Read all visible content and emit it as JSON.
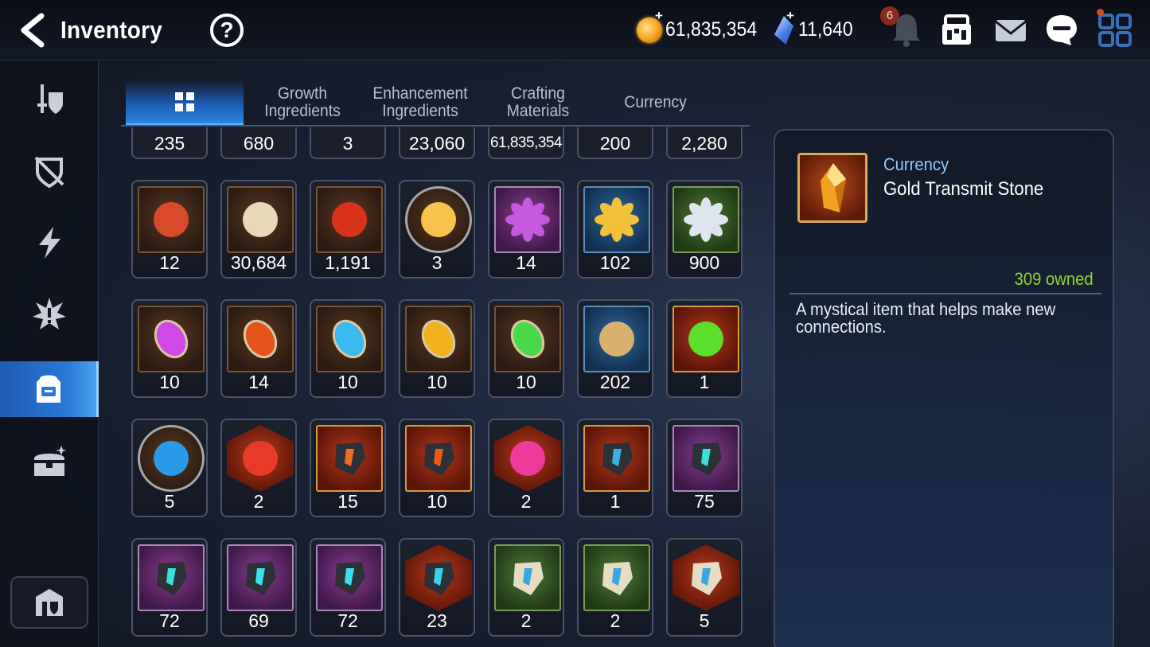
{
  "header": {
    "title": "Inventory",
    "gold_amount": "61,835,354",
    "crystal_amount": "11,640",
    "notification_count": "6",
    "currency_plus": "+"
  },
  "sidebar": {
    "items": [
      {
        "icon": "sword-shield-icon"
      },
      {
        "icon": "broken-shield-icon"
      },
      {
        "icon": "lightning-icon"
      },
      {
        "icon": "burst-icon"
      },
      {
        "icon": "backpack-icon",
        "active": true
      },
      {
        "icon": "chest-icon"
      }
    ],
    "bottom_icon": "fortress-icon"
  },
  "tabs": [
    {
      "label": "",
      "icon": "grid-icon",
      "active": true
    },
    {
      "label": "Growth Ingredients"
    },
    {
      "label": "Enhancement Ingredients"
    },
    {
      "label": "Crafting Materials"
    },
    {
      "label": "Currency"
    }
  ],
  "partial_row_counts": [
    "235",
    "680",
    "3",
    "23,060",
    "61,835,354",
    "200",
    "2,280"
  ],
  "items": [
    {
      "count": "12",
      "icon": "war-banner-icon",
      "frame": "brown"
    },
    {
      "count": "30,684",
      "icon": "horse-statue-icon",
      "frame": "brown"
    },
    {
      "count": "1,191",
      "icon": "red-leaf-icon",
      "frame": "brown"
    },
    {
      "count": "3",
      "icon": "chick-mascot-icon",
      "frame": "round"
    },
    {
      "count": "14",
      "icon": "purple-flower-icon",
      "frame": "purple"
    },
    {
      "count": "102",
      "icon": "gold-flower-icon",
      "frame": "blue"
    },
    {
      "count": "900",
      "icon": "silver-flower-icon",
      "frame": "green"
    },
    {
      "count": "10",
      "icon": "purple-rune-icon",
      "frame": "brown"
    },
    {
      "count": "14",
      "icon": "fire-rune-icon",
      "frame": "brown"
    },
    {
      "count": "10",
      "icon": "ice-rune-icon",
      "frame": "brown"
    },
    {
      "count": "10",
      "icon": "light-rune-icon",
      "frame": "brown"
    },
    {
      "count": "10",
      "icon": "earth-rune-icon",
      "frame": "brown"
    },
    {
      "count": "202",
      "icon": "ginseng-icon",
      "frame": "blue"
    },
    {
      "count": "1",
      "icon": "green-orb-icon",
      "frame": "red"
    },
    {
      "count": "5",
      "icon": "blue-sigil-icon",
      "frame": "round"
    },
    {
      "count": "2",
      "icon": "red-crystal-icon",
      "frame": "hex"
    },
    {
      "count": "15",
      "icon": "red-armor-stone-icon",
      "frame": "red"
    },
    {
      "count": "10",
      "icon": "red-stone-icon",
      "frame": "red"
    },
    {
      "count": "2",
      "icon": "pink-potion-icon",
      "frame": "hex"
    },
    {
      "count": "1",
      "icon": "hammer-stone-icon",
      "frame": "red"
    },
    {
      "count": "75",
      "icon": "sword-stone-icon",
      "frame": "purple"
    },
    {
      "count": "72",
      "icon": "ring-stone-icon",
      "frame": "purple"
    },
    {
      "count": "69",
      "icon": "armor-stone-icon",
      "frame": "purple"
    },
    {
      "count": "72",
      "icon": "boot-stone-icon",
      "frame": "purple"
    },
    {
      "count": "23",
      "icon": "star-stone-icon",
      "frame": "hex"
    },
    {
      "count": "2",
      "icon": "pale-sword-stone-icon",
      "frame": "green"
    },
    {
      "count": "2",
      "icon": "pale-boot-stone-icon",
      "frame": "green"
    },
    {
      "count": "5",
      "icon": "pale-star-stone-icon",
      "frame": "hex"
    }
  ],
  "detail": {
    "category": "Currency",
    "name": "Gold Transmit Stone",
    "owned": "309 owned",
    "description": "A mystical item that helps make new connections.",
    "icon": "gold-transmit-stone-icon"
  },
  "colors": {
    "accent_blue": "#2f86e0",
    "owned_green": "#8dd62f",
    "category_blue": "#8fc8ff"
  }
}
